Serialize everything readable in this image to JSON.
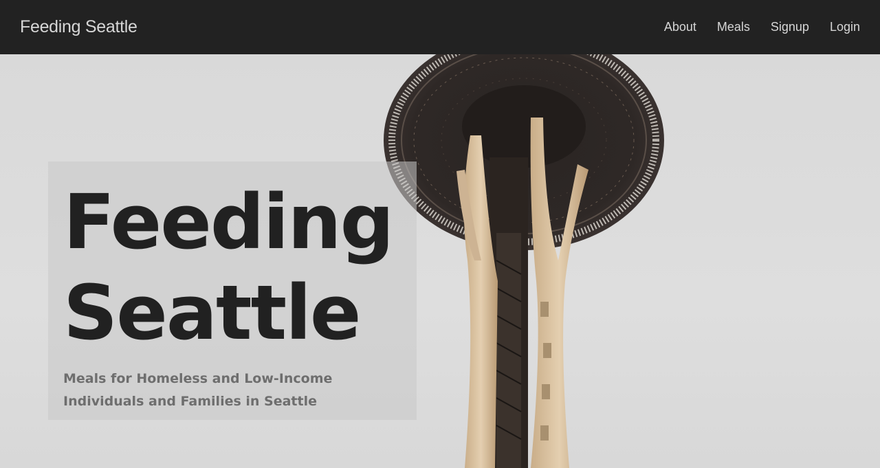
{
  "navbar": {
    "brand": "Feeding Seattle",
    "links": [
      {
        "label": "About"
      },
      {
        "label": "Meals"
      },
      {
        "label": "Signup"
      },
      {
        "label": "Login"
      }
    ]
  },
  "hero": {
    "title_line1": "Feeding",
    "title_line2": "Seattle",
    "subtitle": "Meals for Homeless and Low-Income Individuals and Families in Seattle",
    "image_icon": "space-needle-photo"
  },
  "colors": {
    "navbar_bg": "#222222",
    "nav_text": "#d6d6d6",
    "title_text": "#212121",
    "subtitle_text": "#6e6e6e",
    "hero_bg": "#dcdcdc"
  }
}
